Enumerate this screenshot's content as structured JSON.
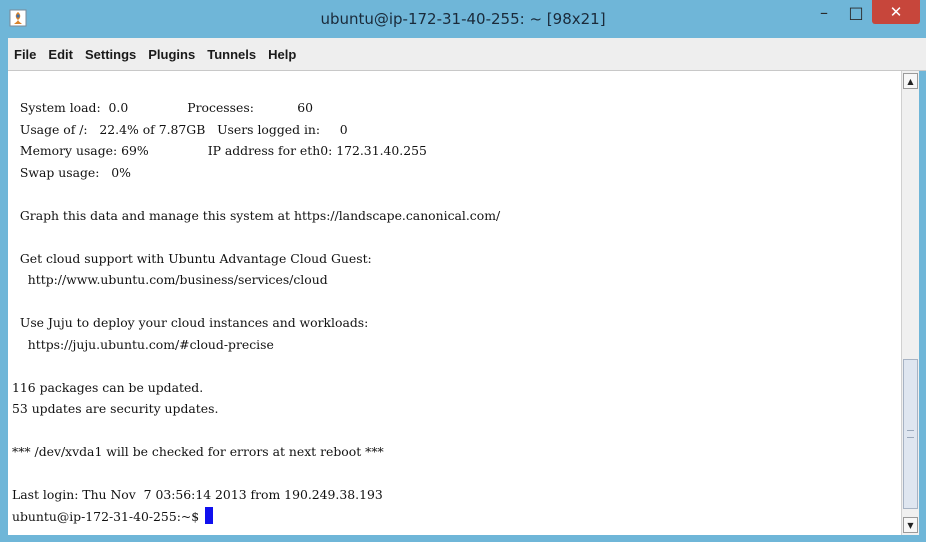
{
  "window": {
    "title": "ubuntu@ip-172-31-40-255: ~ [98x21]",
    "controls": {
      "minimize": "–",
      "maximize": "□",
      "close": "✕"
    },
    "frame_color": "#6fb6d8",
    "close_color": "#c7463b"
  },
  "menu": {
    "items": [
      "File",
      "Edit",
      "Settings",
      "Plugins",
      "Tunnels",
      "Help"
    ]
  },
  "terminal": {
    "lines": [
      "  System load:  0.0               Processes:           60",
      "  Usage of /:   22.4% of 7.87GB   Users logged in:     0",
      "  Memory usage: 69%               IP address for eth0: 172.31.40.255",
      "  Swap usage:   0%",
      "",
      "  Graph this data and manage this system at https://landscape.canonical.com/",
      "",
      "  Get cloud support with Ubuntu Advantage Cloud Guest:",
      "    http://www.ubuntu.com/business/services/cloud",
      "",
      "  Use Juju to deploy your cloud instances and workloads:",
      "    https://juju.ubuntu.com/#cloud-precise",
      "",
      "116 packages can be updated.",
      "53 updates are security updates.",
      "",
      "*** /dev/xvda1 will be checked for errors at next reboot ***",
      "",
      "Last login: Thu Nov  7 03:56:14 2013 from 190.249.38.193"
    ],
    "prompt": "ubuntu@ip-172-31-40-255:~$ ",
    "cursor_color": "#1010ee"
  },
  "scrollbar": {
    "up_arrow": "▲",
    "down_arrow": "▼"
  }
}
